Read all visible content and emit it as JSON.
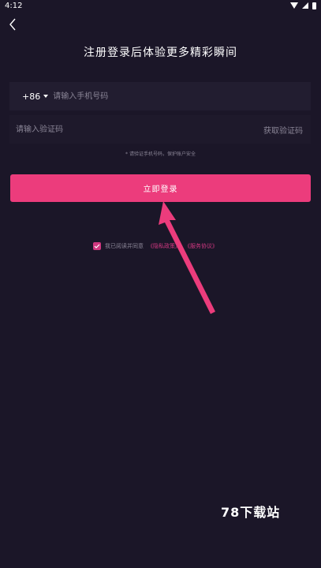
{
  "status_bar": {
    "time": "4:12"
  },
  "header": {
    "back_icon": "chevron-left-icon",
    "title": "注册登录后体验更多精彩瞬间"
  },
  "phone_field": {
    "country_code": "+86",
    "placeholder": "请输入手机号码",
    "value": ""
  },
  "code_field": {
    "placeholder": "请输入验证码",
    "value": "",
    "get_code_label": "获取验证码"
  },
  "notice": "* 请验证手机号码，保护账户安全",
  "login_button_label": "立即登录",
  "agreement": {
    "checked": true,
    "prefix": "我已阅读并同意",
    "privacy_link": "《隐私政策》",
    "terms_link": "《服务协议》"
  },
  "watermark": "78下载站",
  "colors": {
    "background": "#1b1628",
    "accent": "#ec3c7c",
    "input_bg": "#221d30",
    "muted_text": "#8a8596"
  }
}
